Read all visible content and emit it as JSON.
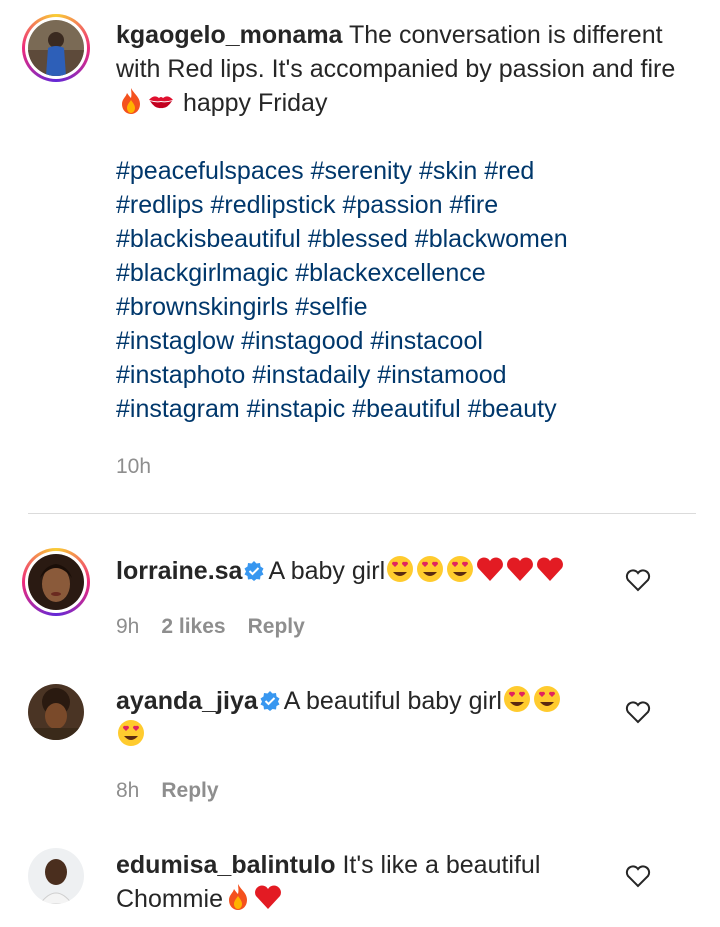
{
  "post": {
    "username": "kgaogelo_monama",
    "caption_before_emojis": " The conversation is different with Red lips. It's accompanied by passion and fire",
    "caption_emojis": [
      "fire",
      "kiss-mark"
    ],
    "caption_after_emojis": " happy Friday",
    "hashtags": "#peacefulspaces #serenity #skin #red\n#redlips #redlipstick #passion #fire\n#blackisbeautiful #blessed #blackwomen\n#blackgirlmagic #blackexcellence\n#brownskingirls #selfie\n#instaglow #instagood #instacool\n#instaphoto #instadaily #instamood\n#instagram #instapic #beautiful #beauty",
    "time": "10h"
  },
  "comments": [
    {
      "username": "lorraine.sa",
      "verified": true,
      "text": "A baby girl",
      "emojis": [
        "heart-eyes",
        "heart-eyes",
        "heart-eyes",
        "red-heart",
        "red-heart",
        "red-heart"
      ],
      "time": "9h",
      "likes": "2 likes",
      "reply": "Reply"
    },
    {
      "username": "ayanda_jiya",
      "verified": true,
      "text": "A beautiful baby girl",
      "emojis": [
        "heart-eyes",
        "heart-eyes",
        "heart-eyes"
      ],
      "time": "8h",
      "reply": "Reply"
    },
    {
      "username": "edumisa_balintulo",
      "verified": false,
      "text": "It's like a beautiful Chommie",
      "emojis": [
        "fire",
        "red-heart"
      ],
      "time": "",
      "reply": ""
    }
  ],
  "colors": {
    "hashtag": "#00376b",
    "verified": "#3897f0",
    "meta": "#8e8e8e",
    "divider": "#dbdbdb"
  }
}
